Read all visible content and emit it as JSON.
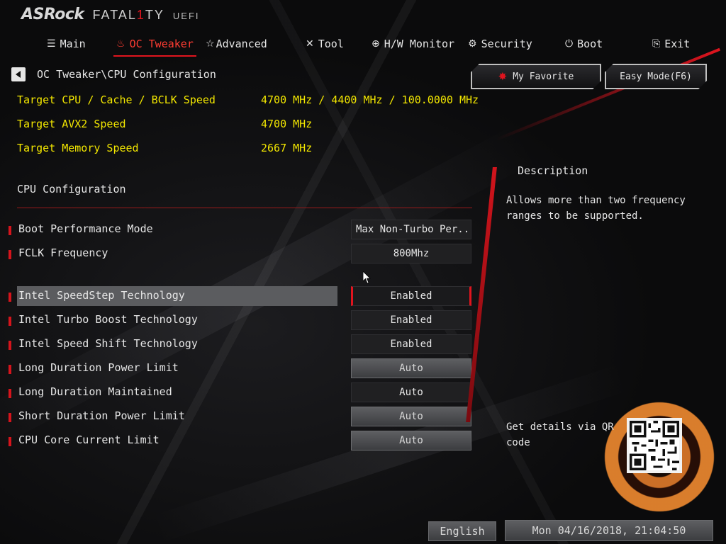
{
  "brand": {
    "asrock": "ASRock",
    "fatal1ty_a": "FATAL",
    "fatal1ty_one": "1",
    "fatal1ty_b": "TY",
    "uefi": "UEFI"
  },
  "tabs": [
    {
      "label": "Main",
      "icon": "list-icon"
    },
    {
      "label": "OC Tweaker",
      "icon": "flame-icon",
      "active": true
    },
    {
      "label": "Advanced",
      "icon": "star-icon"
    },
    {
      "label": "Tool",
      "icon": "tools-icon"
    },
    {
      "label": "H/W Monitor",
      "icon": "crosshair-icon"
    },
    {
      "label": "Security",
      "icon": "shield-gear-icon"
    },
    {
      "label": "Boot",
      "icon": "power-icon"
    },
    {
      "label": "Exit",
      "icon": "exit-icon"
    }
  ],
  "breadcrumb": "OC Tweaker\\CPU Configuration",
  "buttons": {
    "favorite": "My Favorite",
    "easy_mode": "Easy Mode(F6)"
  },
  "targets": [
    {
      "label": "Target CPU / Cache / BCLK Speed",
      "value": "4700 MHz / 4400 MHz / 100.0000 MHz"
    },
    {
      "label": "Target AVX2 Speed",
      "value": "4700 MHz"
    },
    {
      "label": "Target Memory Speed",
      "value": "2667 MHz"
    }
  ],
  "section_title": "CPU Configuration",
  "settings": [
    {
      "label": "Boot Performance Mode",
      "value": "Max Non-Turbo Per..."
    },
    {
      "label": "FCLK Frequency",
      "value": "800Mhz"
    },
    {
      "label": "Intel SpeedStep Technology",
      "value": "Enabled",
      "selected": true
    },
    {
      "label": "Intel Turbo Boost Technology",
      "value": "Enabled"
    },
    {
      "label": "Intel Speed Shift Technology",
      "value": "Enabled"
    },
    {
      "label": "Long Duration Power Limit",
      "value": "Auto"
    },
    {
      "label": "Long Duration Maintained",
      "value": "Auto"
    },
    {
      "label": "Short Duration Power Limit",
      "value": "Auto"
    },
    {
      "label": "CPU Core Current Limit",
      "value": "Auto"
    }
  ],
  "description": {
    "title": "Description",
    "text": "Allows more than two frequency ranges to be supported.",
    "qr_text": "Get details via QR code"
  },
  "footer": {
    "language": "English",
    "datetime": "Mon 04/16/2018, 21:04:50"
  },
  "colors": {
    "accent": "#e0141e",
    "target_text": "#f2e600",
    "highlight": "#5b5c5f"
  }
}
